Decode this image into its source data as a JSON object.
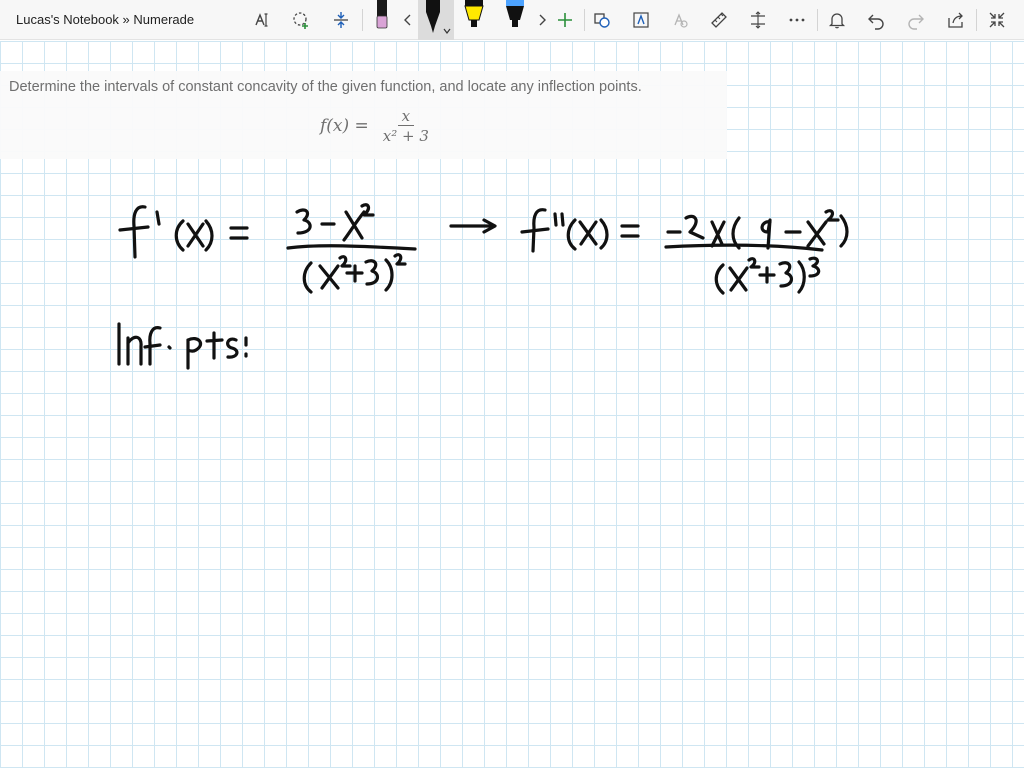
{
  "window": {
    "title": "Lucas's Notebook » Numerade"
  },
  "toolbar": {
    "tools": [
      {
        "name": "text-select-icon"
      },
      {
        "name": "lasso-select-icon"
      },
      {
        "name": "add-space-icon"
      },
      {
        "name": "eraser-icon"
      },
      {
        "name": "scroll-left-icon"
      },
      {
        "name": "pen-black-icon"
      },
      {
        "name": "highlighter-yellow-icon"
      },
      {
        "name": "highlighter-blue-icon"
      },
      {
        "name": "scroll-right-icon"
      },
      {
        "name": "add-pen-icon"
      },
      {
        "name": "ink-to-shape-icon"
      },
      {
        "name": "ink-to-text-icon"
      },
      {
        "name": "ink-to-math-icon"
      },
      {
        "name": "ruler-icon"
      },
      {
        "name": "insert-space-icon"
      },
      {
        "name": "more-icon"
      },
      {
        "name": "notifications-icon"
      },
      {
        "name": "undo-icon"
      },
      {
        "name": "redo-icon"
      },
      {
        "name": "share-icon"
      },
      {
        "name": "fullscreen-icon"
      }
    ],
    "colors": {
      "pen_black": "#111111",
      "highlighter_yellow": "#ffe800",
      "highlighter_blue": "#4da3ff",
      "eraser_pink": "#d9a3d6",
      "accent_green": "#2a8f3a",
      "accent_blue": "#1d5fb8"
    }
  },
  "problem": {
    "prompt": "Determine the intervals of constant concavity of the given function, and locate any inflection points.",
    "formula_lhs": "f(x) =",
    "formula_numerator": "x",
    "formula_denominator": "x² + 3"
  },
  "ink": {
    "line1_first_derivative": "f'(x) = (3 - x²) / (x² + 3)²",
    "line1_second_derivative": "f''(x) = -2x(9 - x²) / (x² + 3)³",
    "line2_label": "Inf. Pts:"
  }
}
